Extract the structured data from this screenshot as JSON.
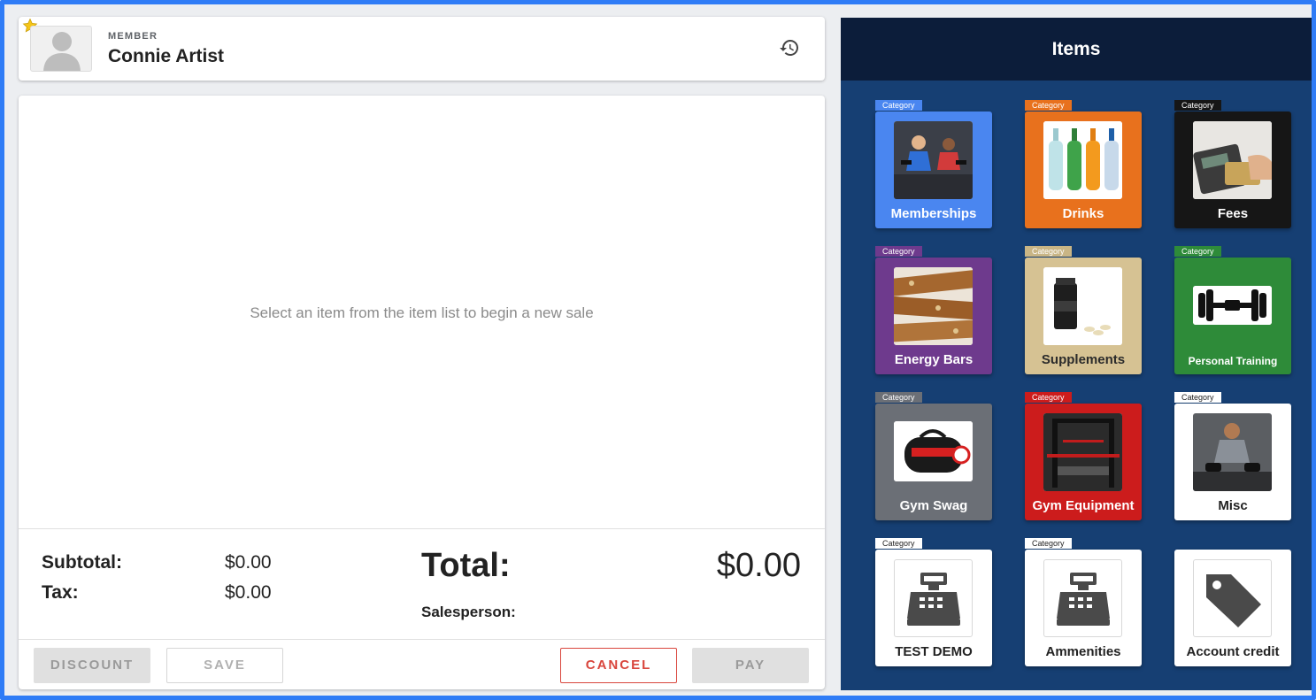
{
  "member": {
    "label": "MEMBER",
    "name": "Connie Artist"
  },
  "sale": {
    "empty_message": "Select an item from the item list to begin a new sale",
    "subtotal_label": "Subtotal:",
    "subtotal_value": "$0.00",
    "tax_label": "Tax:",
    "tax_value": "$0.00",
    "total_label": "Total:",
    "total_value": "$0.00",
    "salesperson_label": "Salesperson:"
  },
  "actions": {
    "discount": "DISCOUNT",
    "save": "SAVE",
    "cancel": "CANCEL",
    "pay": "PAY"
  },
  "items": {
    "title": "Items",
    "tiles": [
      {
        "tag": "Category",
        "name": "Memberships",
        "color": "#4a86f0",
        "tag_color": "#4a86f0",
        "text_color": "#ffffff",
        "icon": "group-fitness-photo"
      },
      {
        "tag": "Category",
        "name": "Drinks",
        "color": "#e8711d",
        "tag_color": "#e8711d",
        "text_color": "#ffffff",
        "icon": "bottles-photo"
      },
      {
        "tag": "Category",
        "name": "Fees",
        "color": "#161616",
        "tag_color": "#161616",
        "text_color": "#ffffff",
        "icon": "card-terminal-photo"
      },
      {
        "tag": "Category",
        "name": "Energy Bars",
        "color": "#6e3a8d",
        "tag_color": "#6e3a8d",
        "text_color": "#ffffff",
        "icon": "energy-bar-photo"
      },
      {
        "tag": "Category",
        "name": "Supplements",
        "color": "#d6c293",
        "tag_color": "#c9b585",
        "text_color": "#2b2b2b",
        "icon": "supplement-jar-photo"
      },
      {
        "tag": "Category",
        "name": "Personal Training",
        "color": "#2e8b39",
        "tag_color": "#2e8b39",
        "text_color": "#ffffff",
        "icon": "dumbbell-icon"
      },
      {
        "tag": "Category",
        "name": "Gym Swag",
        "color": "#6b6f76",
        "tag_color": "#6b6f76",
        "text_color": "#ffffff",
        "icon": "gym-bag-photo"
      },
      {
        "tag": "Category",
        "name": "Gym Equipment",
        "color": "#cc1c1c",
        "tag_color": "#cc1c1c",
        "text_color": "#ffffff",
        "icon": "power-rack-photo"
      },
      {
        "tag": "Category",
        "name": "Misc",
        "color": "#ffffff",
        "tag_color": "#ffffff",
        "text_color": "#222222",
        "icon": "athlete-photo"
      },
      {
        "tag": "Category",
        "name": "TEST DEMO",
        "color": "#ffffff",
        "tag_color": "#ffffff",
        "text_color": "#222222",
        "icon": "cash-register-icon"
      },
      {
        "tag": "Category",
        "name": "Ammenities",
        "color": "#ffffff",
        "tag_color": "#ffffff",
        "text_color": "#222222",
        "icon": "cash-register-icon"
      },
      {
        "tag": "",
        "name": "Account credit",
        "color": "#ffffff",
        "tag_color": "#ffffff",
        "text_color": "#222222",
        "icon": "price-tag-icon"
      }
    ]
  }
}
